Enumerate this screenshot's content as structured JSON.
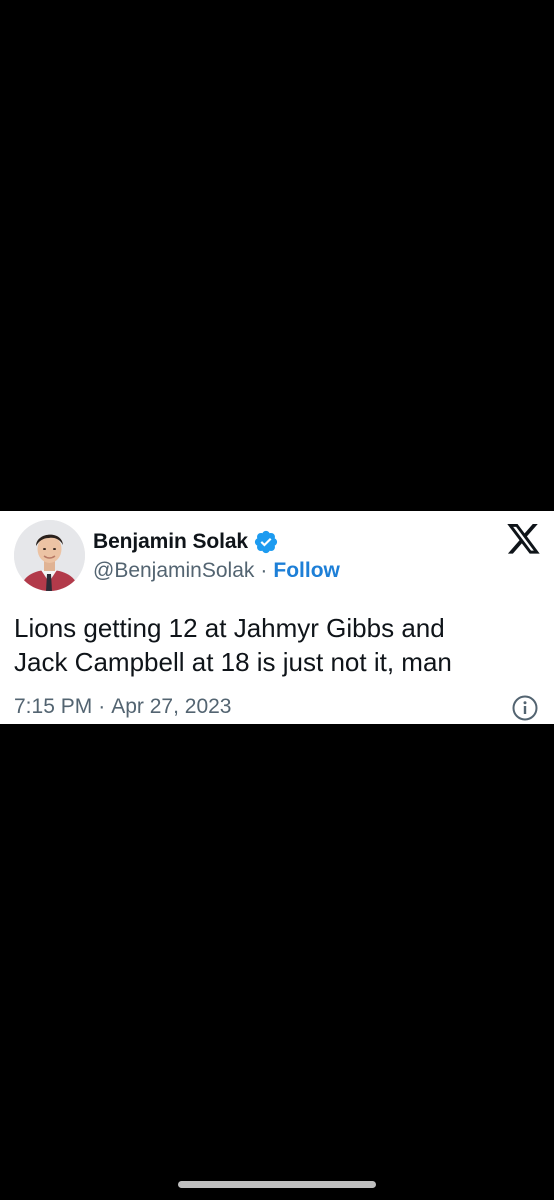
{
  "tweet": {
    "display_name": "Benjamin Solak",
    "handle": "@BenjaminSolak",
    "separator": "·",
    "follow_label": "Follow",
    "text_lines": [
      "Lions getting 12 at Jahmyr Gibbs and",
      "Jack Campbell at 18 is just not it, man"
    ],
    "time": "7:15 PM",
    "date": "Apr 27, 2023"
  },
  "icons": {
    "verified": "verified-badge-icon",
    "brand": "x-logo-icon",
    "info": "info-icon"
  },
  "colors": {
    "background": "#000000",
    "card": "#ffffff",
    "text_primary": "#0f1419",
    "text_secondary": "#536471",
    "accent": "#1d7fd7",
    "verified": "#1d9bf0"
  }
}
